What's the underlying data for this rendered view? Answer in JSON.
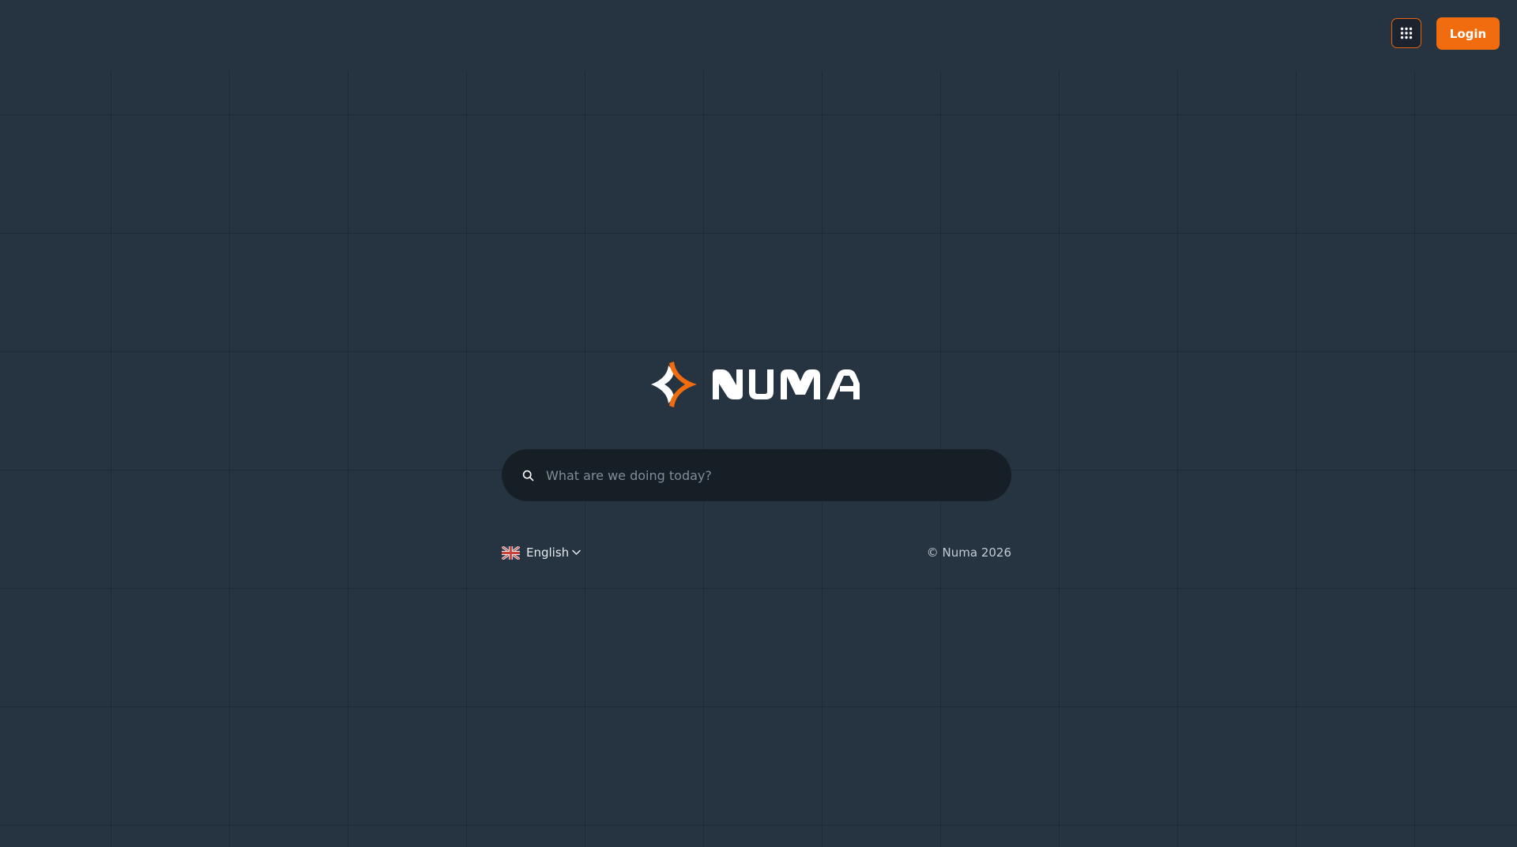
{
  "header": {
    "apps_icon": "grid-dots-icon",
    "login_label": "Login"
  },
  "logo": {
    "wordmark": "NUMA",
    "mark_icon": "numa-star-icon"
  },
  "search": {
    "placeholder": "What are we doing today?",
    "value": "",
    "icon": "search-icon"
  },
  "footer": {
    "language": {
      "label": "English",
      "flag_icon": "uk-flag-icon",
      "chevron_icon": "chevron-down-icon"
    },
    "copyright": "© Numa 2026"
  },
  "colors": {
    "background": "#263340",
    "accent": "#f06c0e",
    "search_bg": "#161e26",
    "text_primary": "#ffffff"
  }
}
